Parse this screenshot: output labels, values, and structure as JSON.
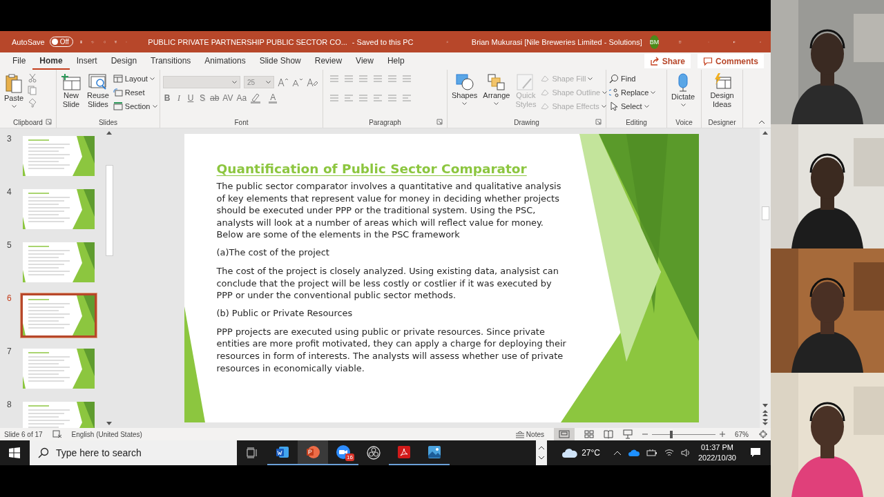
{
  "window": {
    "title": "PUBLIC PRIVATE PARTNERSHIP PUBLIC SECTOR CO...",
    "save_status": "- Saved to this PC",
    "user": "Brian Mukurasi [Nile Breweries Limited - Solutions]",
    "user_initials": "BM"
  },
  "autosave": {
    "label": "AutoSave",
    "state": "Off",
    "on": false
  },
  "tabs": [
    {
      "label": "File",
      "selected": false
    },
    {
      "label": "Home",
      "selected": true
    },
    {
      "label": "Insert",
      "selected": false
    },
    {
      "label": "Design",
      "selected": false
    },
    {
      "label": "Transitions",
      "selected": false
    },
    {
      "label": "Animations",
      "selected": false
    },
    {
      "label": "Slide Show",
      "selected": false
    },
    {
      "label": "Review",
      "selected": false
    },
    {
      "label": "View",
      "selected": false
    },
    {
      "label": "Help",
      "selected": false
    }
  ],
  "share": "Share",
  "comments": "Comments",
  "ribbon": {
    "clipboard": {
      "label": "Clipboard",
      "paste": "Paste"
    },
    "slides": {
      "label": "Slides",
      "new_slide": "New Slide",
      "reuse_slides": "Reuse Slides",
      "layout": "Layout",
      "reset": "Reset",
      "section": "Section"
    },
    "font": {
      "label": "Font",
      "size": "25",
      "buttons": [
        {
          "label": "B",
          "kind": "bold"
        },
        {
          "label": "I",
          "kind": "italic"
        },
        {
          "label": "U",
          "kind": "underline"
        },
        {
          "label": "S",
          "kind": "shadow"
        },
        {
          "label": "ab",
          "kind": "strike"
        },
        {
          "label": "AV",
          "kind": "spacing"
        },
        {
          "label": "Aa",
          "kind": "case"
        }
      ],
      "color_label": "A"
    },
    "paragraph": {
      "label": "Paragraph"
    },
    "drawing": {
      "label": "Drawing",
      "shapes": "Shapes",
      "arrange": "Arrange",
      "quick_styles": {
        "label": "Quick Styles",
        "disabled": true
      },
      "format_items": [
        {
          "label": "Shape Fill",
          "disabled": true
        },
        {
          "label": "Shape Outline",
          "disabled": true
        },
        {
          "label": "Shape Effects",
          "disabled": true
        }
      ]
    },
    "editing": {
      "label": "Editing",
      "find": "Find",
      "replace": "Replace",
      "select": "Select"
    },
    "voice": {
      "label": "Voice",
      "dictate": "Dictate"
    },
    "designer": {
      "label": "Designer",
      "design_ideas": "Design Ideas"
    }
  },
  "slides": [
    {
      "number": "3",
      "selected": false
    },
    {
      "number": "4",
      "selected": false
    },
    {
      "number": "5",
      "selected": false
    },
    {
      "number": "6",
      "selected": true
    },
    {
      "number": "7",
      "selected": false
    },
    {
      "number": "8",
      "selected": false
    }
  ],
  "slide": {
    "title": "Quantification of Public Sector Comparator",
    "blocks": [
      {
        "kind": "paragraph",
        "text": "The public sector comparator involves a quantitative and qualitative analysis of key elements that represent value for money in deciding whether projects should be executed under PPP or the traditional system. Using the PSC, analysts will look at a number of areas which will reflect value for money. Below are some of the elements in the PSC framework"
      },
      {
        "kind": "heading",
        "text": "(a)The cost of the project"
      },
      {
        "kind": "paragraph",
        "text": "The cost of the project is closely analyzed. Using existing data, analysist can conclude that the project will be less costly or costlier if it was executed by PPP or under the conventional public sector methods."
      },
      {
        "kind": "heading",
        "text": "(b) Public or Private Resources"
      },
      {
        "kind": "paragraph",
        "text": "PPP projects are executed using public or private resources. Since private entities are more profit motivated, they can apply a charge for deploying their resources in form of interests. The analysts will assess whether use of private resources in economically viable."
      }
    ]
  },
  "status_bar": {
    "slide_position": "Slide 6 of 17",
    "language": "English (United States)",
    "notes": "Notes",
    "zoom_percent": "67%",
    "zoom": {
      "level": 0.3
    }
  },
  "taskbar": {
    "search_placeholder": "Type here to search",
    "zoom_badge": "16",
    "temperature": "27°C",
    "time": "01:37 PM",
    "date": "2022/10/30"
  }
}
